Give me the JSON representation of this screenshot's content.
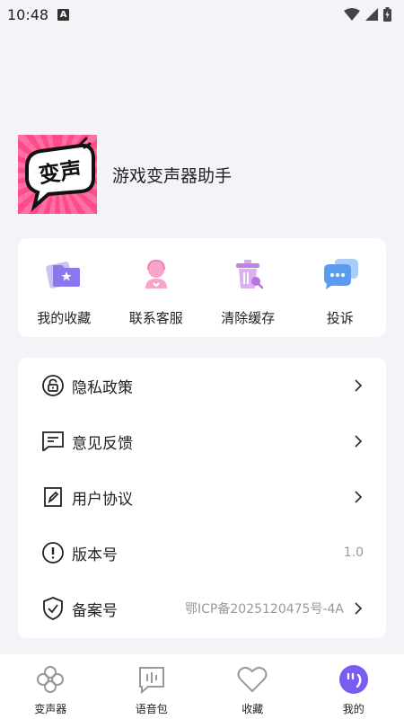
{
  "status_bar": {
    "time": "10:48",
    "notif_letter": "A"
  },
  "profile": {
    "app_name": "游戏变声器助手",
    "logo_text": "变声"
  },
  "actions": [
    {
      "label": "我的收藏",
      "icon": "folder-star-icon"
    },
    {
      "label": "联系客服",
      "icon": "customer-service-icon"
    },
    {
      "label": "清除缓存",
      "icon": "trash-icon"
    },
    {
      "label": "投诉",
      "icon": "chat-bubble-icon"
    }
  ],
  "settings": [
    {
      "label": "隐私政策",
      "icon": "lock-icon"
    },
    {
      "label": "意见反馈",
      "icon": "message-icon"
    },
    {
      "label": "用户协议",
      "icon": "edit-document-icon"
    },
    {
      "label": "版本号",
      "value": "1.0",
      "icon": "info-icon"
    },
    {
      "label": "备案号",
      "value": "鄂ICP备2025120475号-4A",
      "icon": "shield-check-icon"
    }
  ],
  "tabs": [
    {
      "label": "变声器",
      "icon": "clover-icon"
    },
    {
      "label": "语音包",
      "icon": "voice-pack-icon"
    },
    {
      "label": "收藏",
      "icon": "heart-icon"
    },
    {
      "label": "我的",
      "icon": "profile-face-icon",
      "active": true
    }
  ],
  "colors": {
    "accent": "#7b5cf0",
    "logo_pink": "#ff4b8a",
    "background": "#f3f3f8"
  }
}
